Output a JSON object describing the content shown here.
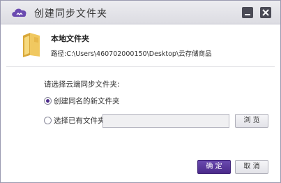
{
  "window": {
    "title": "创建同步文件夹"
  },
  "folder": {
    "name": "本地文件夹",
    "path_label": "路径:",
    "path_value": "C:\\Users\\460702000150\\Desktop\\云存储商品"
  },
  "sync": {
    "prompt": "请选择云端同步文件夹:",
    "option_new": "创建同名的新文件夹",
    "option_existing": "选择已有文件夹",
    "selected_option": "option_new",
    "existing_path_value": "",
    "browse_label": "浏 览"
  },
  "footer": {
    "ok_label": "确 定",
    "cancel_label": "取 消"
  },
  "colors": {
    "accent": "#4b2a8a",
    "folder": "#e0b84a"
  }
}
